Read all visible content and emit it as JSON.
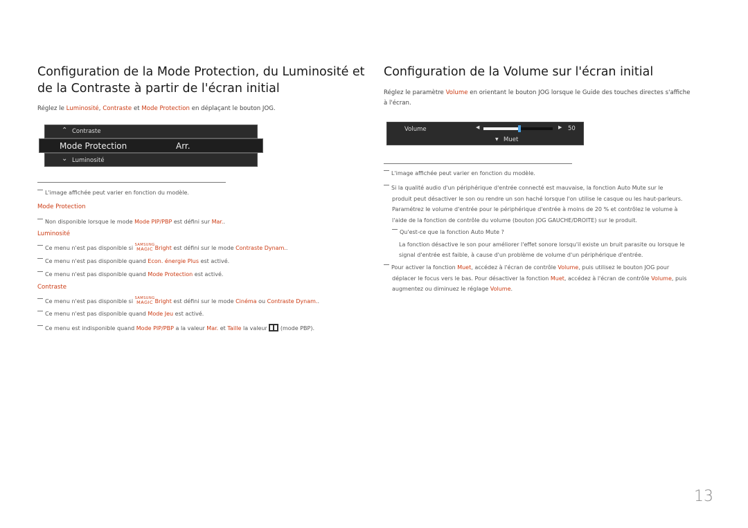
{
  "left": {
    "title_line1": "Configuration de la Mode Protection, du Luminosité et",
    "title_line2": "de la Contraste à partir de l'écran initial",
    "intro": {
      "t1": "Réglez le ",
      "h1": "Luminosité",
      "t2": ", ",
      "h2": "Contraste",
      "t3": " et ",
      "h3": "Mode Protection",
      "t4": " en déplaçant le bouton JOG."
    },
    "osd": {
      "up_label": "Contraste",
      "main_label": "Mode Protection",
      "main_value": "Arr.",
      "down_label": "Luminosité"
    },
    "image_note": "L'image affichée peut varier en fonction du modèle.",
    "sections": {
      "mode_protection": {
        "heading": "Mode Protection",
        "note1": {
          "t1": "Non disponible lorsque le mode ",
          "h1": "Mode PIP/PBP",
          "t2": " est défini sur ",
          "h2": "Mar.",
          "t3": "."
        }
      },
      "luminosite": {
        "heading": "Luminosité",
        "note1": {
          "t1": "Ce menu n'est pas disponible si ",
          "brand_small": "SAMSUNG",
          "brand_magic": "MAGIC",
          "h1": "Bright",
          "t2": " est défini sur le mode ",
          "h2": "Contraste Dynam.",
          "t3": "."
        },
        "note2": {
          "t1": "Ce menu n'est pas disponible quand ",
          "h1": "Econ. énergie Plus",
          "t2": " est activé."
        },
        "note3": {
          "t1": "Ce menu n'est pas disponible quand ",
          "h1": "Mode Protection",
          "t2": " est activé."
        }
      },
      "contraste": {
        "heading": "Contraste",
        "note1": {
          "t1": "Ce menu n'est pas disponible si ",
          "brand_small": "SAMSUNG",
          "brand_magic": "MAGIC",
          "h1": "Bright",
          "t2": " est défini sur le mode ",
          "h2": "Cinéma",
          "t3": " ou ",
          "h3": "Contraste Dynam.",
          "t4": "."
        },
        "note2": {
          "t1": "Ce menu n'est pas disponible quand ",
          "h1": "Mode Jeu",
          "t2": " est activé."
        },
        "note3": {
          "t1": "Ce menu est indisponible quand ",
          "h1": "Mode PIP/PBP",
          "t2": " a la valeur ",
          "h2": "Mar.",
          "t3": " et ",
          "h3": "Taille",
          "t4": " la valeur ",
          "icon": "pbp-split-icon",
          "t5": " (mode PBP)."
        }
      }
    }
  },
  "right": {
    "title": "Configuration de la Volume sur l'écran initial",
    "intro": {
      "t1": "Réglez le paramètre ",
      "h1": "Volume",
      "t2": " en orientant le bouton JOG lorsque le Guide des touches directes s'affiche",
      "t3": "à l'écran."
    },
    "osd": {
      "label": "Volume",
      "value": "50",
      "level_percent": 50,
      "mute_label": "Muet",
      "accent": "#4a9fe0"
    },
    "notes": {
      "n1": "L'image affichée peut varier en fonction du modèle.",
      "n2_l1": "Si la qualité audio d'un périphérique d'entrée connecté est mauvaise, la fonction Auto Mute sur le",
      "n2_l2": "produit peut désactiver le son ou rendre un son haché lorsque l'on utilise le casque ou les haut-parleurs.",
      "n2_l3": "Paramétrez le volume d'entrée pour le périphérique d'entrée à moins de 20 % et contrôlez le volume à",
      "n2_l4": "l'aide de la fonction de contrôle du volume (bouton JOG GAUCHE/DROITE) sur le produit.",
      "n3": "Qu'est-ce que la fonction Auto Mute ?",
      "n3_l1": "La fonction désactive le son pour améliorer l'effet sonore lorsqu'il existe un bruit parasite ou lorsque le",
      "n3_l2": "signal d'entrée est faible, à cause d'un problème de volume d'un périphérique d'entrée.",
      "n4": {
        "t1": "Pour activer la fonction ",
        "h1": "Muet",
        "t2": ", accédez à l'écran de contrôle ",
        "h2": "Volume",
        "t3": ", puis utilisez le bouton JOG pour",
        "t4": "déplacer le focus vers le bas. Pour désactiver la fonction ",
        "h3": "Muet",
        "t5": ", accédez à l'écran de contrôle ",
        "h4": "Volume",
        "t6": ", puis",
        "t7": "augmentez ou diminuez le réglage ",
        "h5": "Volume",
        "t8": "."
      }
    }
  },
  "page_number": "13",
  "colors": {
    "highlight": "#cc3b13",
    "osd_bg": "#2b2b2b"
  }
}
